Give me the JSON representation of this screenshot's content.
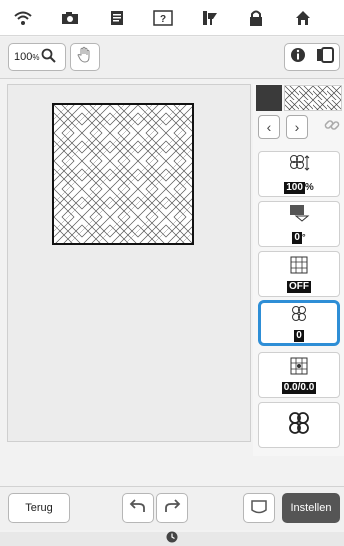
{
  "topbar": {
    "icons": [
      "wifi-icon",
      "camera-icon",
      "document-icon",
      "help-icon",
      "thread-icon",
      "lock-icon",
      "home-icon"
    ]
  },
  "toolbar": {
    "zoom_value": "100",
    "zoom_unit": "%",
    "hand_icon": "hand-icon",
    "info_icon": "info-icon",
    "screen_icon": "screen-icon"
  },
  "panel": {
    "size_value": "100",
    "size_unit": "%",
    "angle_value": "0",
    "angle_unit": "°",
    "toggle_value": "OFF",
    "selected_value": "0",
    "offset_value": "0.0/0.0"
  },
  "bottom": {
    "back_label": "Terug",
    "set_label": "Instellen"
  },
  "colors": {
    "accent": "#2e8ed6",
    "set_button": "#555555"
  }
}
